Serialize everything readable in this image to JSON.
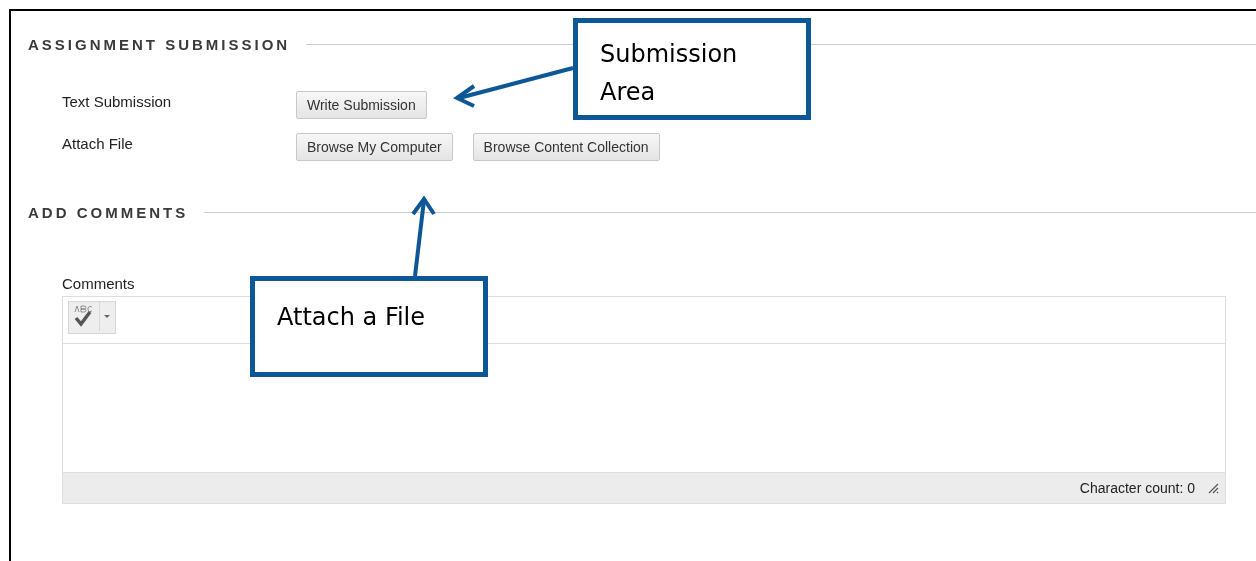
{
  "sections": [
    {
      "title": "ASSIGNMENT SUBMISSION",
      "rows": [
        {
          "label": "Text Submission",
          "buttons": [
            "Write Submission"
          ]
        },
        {
          "label": "Attach File",
          "buttons": [
            "Browse My Computer",
            "Browse Content Collection"
          ]
        }
      ]
    },
    {
      "title": "ADD COMMENTS"
    }
  ],
  "comments": {
    "label": "Comments",
    "character_count": "Character count: 0"
  },
  "callouts": [
    {
      "text": "Submission Area"
    },
    {
      "text": "Attach a File"
    }
  ]
}
